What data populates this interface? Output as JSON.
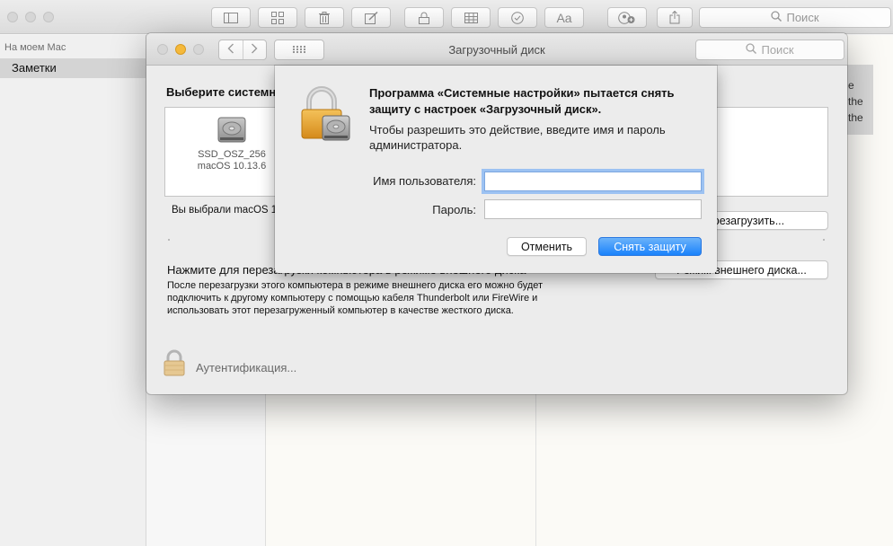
{
  "notes": {
    "search_placeholder": "Поиск",
    "sidebar_header": "На моем Mac",
    "sidebar_item": "Заметки",
    "editor_fragment": [
      "e",
      "the",
      "the"
    ],
    "toolbar_icons": [
      "sidebar-toggle-icon",
      "gallery-icon",
      "trash-icon",
      "compose-icon",
      "lock-icon",
      "table-icon",
      "checklist-icon",
      "text-format-icon",
      "share-people-icon",
      "share-icon"
    ]
  },
  "prefs": {
    "title": "Загрузочный диск",
    "search_placeholder": "Поиск",
    "choose_title": "Выберите системный диск для загрузки компьютера",
    "disk": {
      "name": "SSD_OSZ_256",
      "os": "macOS 10.13.6"
    },
    "selected_text": "Вы выбрали macOS 10.13.6 на томе «SSD_OSZ_256».",
    "restart_label": "Перезагрузить...",
    "tdm_title": "Нажмите для перезагрузки компьютера в режиме внешнего диска",
    "tdm_description": "После перезагрузки этого компьютера в режиме внешнего диска его можно будет подключить к другому компьютеру с помощью кабеля Thunderbolt или FireWire и использовать этот перезагруженный компьютер в качестве жесткого диска.",
    "tdm_button": "Режим внешнего диска...",
    "auth_text": "Аутентификация..."
  },
  "sheet": {
    "heading": "Программа «Системные настройки» пытается снять защиту с настроек «Загрузочный диск».",
    "info": "Чтобы разрешить это действие, введите имя и пароль администратора.",
    "username_label": "Имя пользователя:",
    "username_value": "",
    "password_label": "Пароль:",
    "password_value": "",
    "cancel_label": "Отменить",
    "unlock_label": "Снять защиту"
  },
  "colors": {
    "accent_blue": "#1a82fb",
    "focus_ring": "#9cc2f2",
    "minimize_yellow": "#f5b93b"
  }
}
